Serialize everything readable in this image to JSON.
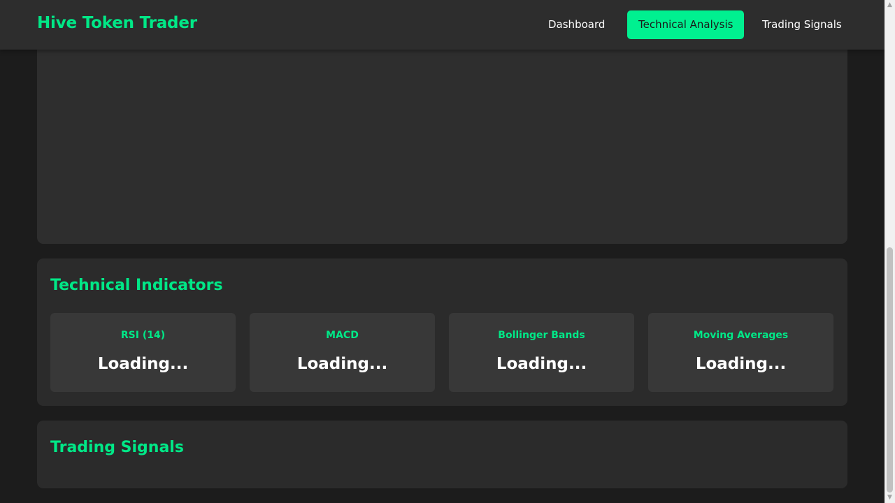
{
  "app": {
    "title": "Hive Token Trader"
  },
  "nav": {
    "items": [
      {
        "label": "Dashboard",
        "active": false
      },
      {
        "label": "Technical Analysis",
        "active": true
      },
      {
        "label": "Trading Signals",
        "active": false
      }
    ]
  },
  "indicators": {
    "title": "Technical Indicators",
    "cards": [
      {
        "label": "RSI (14)",
        "value": "Loading..."
      },
      {
        "label": "MACD",
        "value": "Loading..."
      },
      {
        "label": "Bollinger Bands",
        "value": "Loading..."
      },
      {
        "label": "Moving Averages",
        "value": "Loading..."
      }
    ]
  },
  "signals": {
    "title": "Trading Signals"
  },
  "scrollbar": {
    "position_fraction": 0.5
  },
  "colors": {
    "accent": "#00e887",
    "active_nav_bg": "#00f090",
    "page_bg": "#1c1c1c",
    "panel_bg": "#2b2b2b",
    "card_bg": "#383838",
    "navbar_bg": "#2d2d2d"
  }
}
